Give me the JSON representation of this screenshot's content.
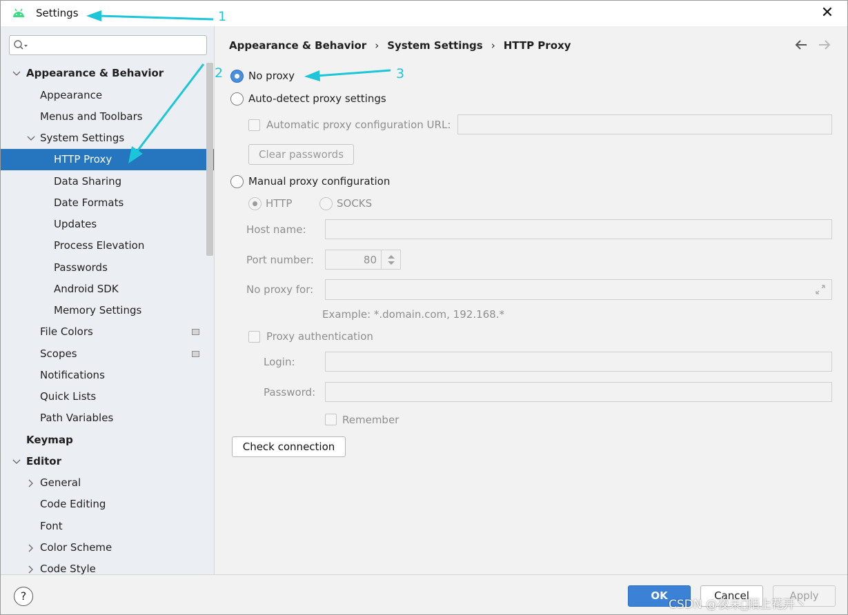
{
  "window": {
    "title": "Settings"
  },
  "sidebar": {
    "items": [
      {
        "label": "Appearance & Behavior"
      },
      {
        "label": "Appearance"
      },
      {
        "label": "Menus and Toolbars"
      },
      {
        "label": "System Settings"
      },
      {
        "label": "HTTP Proxy"
      },
      {
        "label": "Data Sharing"
      },
      {
        "label": "Date Formats"
      },
      {
        "label": "Updates"
      },
      {
        "label": "Process Elevation"
      },
      {
        "label": "Passwords"
      },
      {
        "label": "Android SDK"
      },
      {
        "label": "Memory Settings"
      },
      {
        "label": "File Colors"
      },
      {
        "label": "Scopes"
      },
      {
        "label": "Notifications"
      },
      {
        "label": "Quick Lists"
      },
      {
        "label": "Path Variables"
      },
      {
        "label": "Keymap"
      },
      {
        "label": "Editor"
      },
      {
        "label": "General"
      },
      {
        "label": "Code Editing"
      },
      {
        "label": "Font"
      },
      {
        "label": "Color Scheme"
      },
      {
        "label": "Code Style"
      }
    ]
  },
  "breadcrumb": [
    "Appearance & Behavior",
    "System Settings",
    "HTTP Proxy"
  ],
  "breadcrumb_sep": "›",
  "proxy": {
    "no_proxy": "No proxy",
    "auto_detect": "Auto-detect proxy settings",
    "auto_url_label": "Automatic proxy configuration URL:",
    "clear_passwords": "Clear passwords",
    "manual": "Manual proxy configuration",
    "http": "HTTP",
    "socks": "SOCKS",
    "host_label": "Host name:",
    "port_label": "Port number:",
    "port_value": "80",
    "no_proxy_for_label": "No proxy for:",
    "example": "Example: *.domain.com, 192.168.*",
    "proxy_auth": "Proxy authentication",
    "login_label": "Login:",
    "password_label": "Password:",
    "remember": "Remember",
    "check_connection": "Check connection",
    "selected_mode": "No proxy"
  },
  "footer": {
    "ok": "OK",
    "cancel": "Cancel",
    "apply": "Apply",
    "help": "?"
  },
  "watermark": "CSDN @夜未央̆陌上花开丶",
  "annotations": {
    "n1": "1",
    "n2": "2",
    "n3": "3",
    "color": "#1ac6d8"
  },
  "colors": {
    "selection": "#2675bf",
    "primary_button": "#3b82d7",
    "android": "#3ddc84"
  }
}
